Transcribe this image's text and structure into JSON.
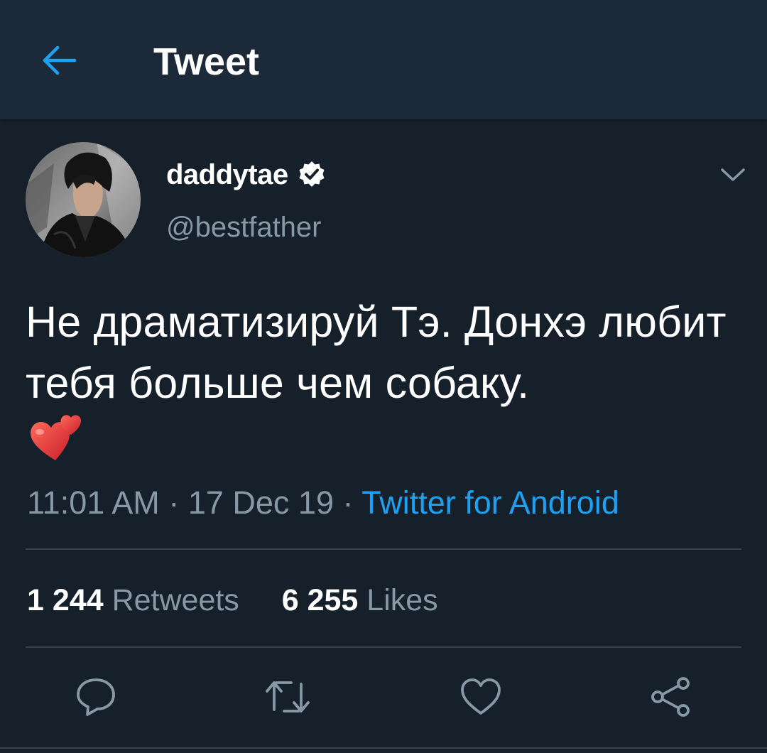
{
  "header": {
    "title": "Tweet",
    "back_icon": "arrow-left-icon"
  },
  "colors": {
    "background": "#15202b",
    "header_background": "#1c2938",
    "accent": "#1da1f2",
    "secondary_text": "#8899a6",
    "divider": "#38444d"
  },
  "tweet": {
    "display_name": "daddytae",
    "verified": true,
    "handle": "@bestfather",
    "text": "Не драматизируй Тэ. Донхэ любит тебя больше чем собаку.",
    "emoji": "💕",
    "time": "11:01 AM",
    "date": "17 Dec 19",
    "separator": "·",
    "source": "Twitter for Android"
  },
  "stats": {
    "retweets_count": "1 244",
    "retweets_label": "Retweets",
    "likes_count": "6 255",
    "likes_label": "Likes"
  },
  "actions": [
    {
      "name": "reply",
      "icon": "comment-icon"
    },
    {
      "name": "retweet",
      "icon": "retweet-icon"
    },
    {
      "name": "like",
      "icon": "heart-outline-icon"
    },
    {
      "name": "share",
      "icon": "share-icon"
    }
  ]
}
